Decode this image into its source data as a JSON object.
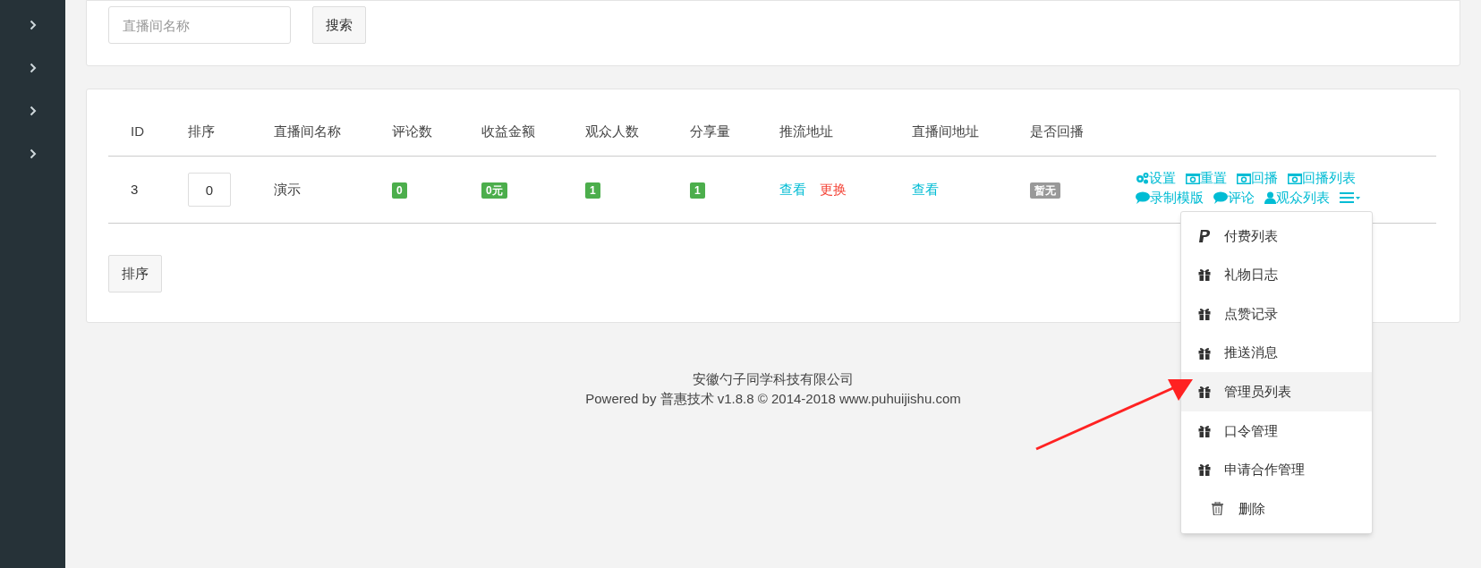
{
  "sidebar": {
    "items": [
      {
        "kind": "chevron"
      },
      {
        "kind": "chevron"
      },
      {
        "kind": "chevron"
      },
      {
        "kind": "chevron"
      }
    ]
  },
  "search": {
    "placeholder": "直播间名称",
    "button": "搜索"
  },
  "table": {
    "columns": [
      "ID",
      "排序",
      "直播间名称",
      "评论数",
      "收益金额",
      "观众人数",
      "分享量",
      "推流地址",
      "直播间地址",
      "是否回播"
    ],
    "rows": [
      {
        "id": "3",
        "sort": "0",
        "name": "演示",
        "badges": [
          {
            "text": "0",
            "color": "#4cae4c"
          },
          {
            "text": "0元",
            "color": "#4cae4c"
          },
          {
            "text": "1",
            "color": "#4cae4c"
          },
          {
            "text": "1",
            "color": "#4cae4c"
          }
        ],
        "push_links": [
          {
            "text": "查看",
            "color": "#00bcd4"
          },
          {
            "text": "更换",
            "color": "#f44336"
          }
        ],
        "room_links": [
          {
            "text": "查看",
            "color": "#00bcd4"
          }
        ],
        "replay": {
          "text": "暂无",
          "color": "#999999"
        },
        "actions": [
          [
            {
              "kind": "gear",
              "text": "设置"
            },
            {
              "kind": "camera",
              "text": "重置"
            },
            {
              "kind": "camera",
              "text": "回播"
            },
            {
              "kind": "camera",
              "text": "回播列表"
            }
          ],
          [
            {
              "kind": "comment",
              "text": "录制模版"
            },
            {
              "kind": "comment",
              "text": "评论"
            },
            {
              "kind": "user",
              "text": "观众列表"
            },
            {
              "kind": "menu"
            }
          ]
        ]
      }
    ]
  },
  "sort_button": "排序",
  "dropdown": {
    "items": [
      {
        "kind": "payment",
        "label": "付费列表",
        "selected": false
      },
      {
        "kind": "gift",
        "label": "礼物日志",
        "selected": false
      },
      {
        "kind": "gift",
        "label": "点赞记录",
        "selected": false
      },
      {
        "kind": "gift",
        "label": "推送消息",
        "selected": false
      },
      {
        "kind": "gift",
        "label": "管理员列表",
        "selected": true
      },
      {
        "kind": "gift",
        "label": "口令管理",
        "selected": false
      },
      {
        "kind": "gift",
        "label": "申请合作管理",
        "selected": false
      },
      {
        "kind": "delete",
        "label": "删除",
        "selected": false
      }
    ]
  },
  "footer": {
    "company": "安徽勺子同学科技有限公司",
    "powered": "Powered by 普惠技术 v1.8.8 © 2014-2018 www.puhuijishu.com"
  }
}
